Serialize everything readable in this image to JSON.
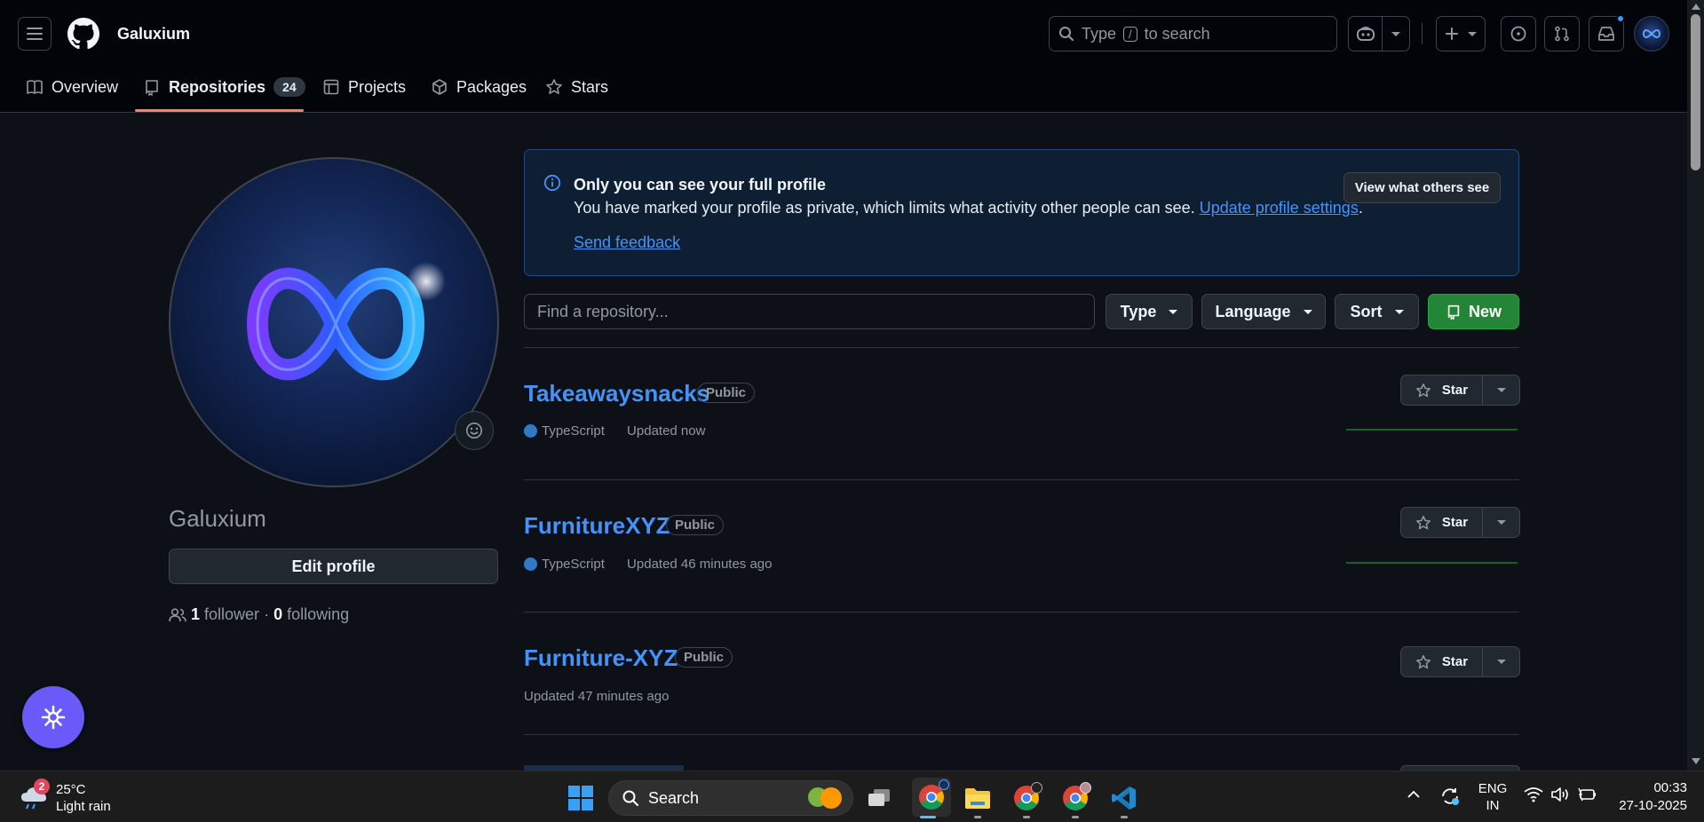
{
  "header": {
    "username": "Galuxium",
    "search_prefix": "Type",
    "search_key": "/",
    "search_suffix": "to search"
  },
  "tabs": [
    {
      "label": "Overview"
    },
    {
      "label": "Repositories",
      "count": "24"
    },
    {
      "label": "Projects"
    },
    {
      "label": "Packages"
    },
    {
      "label": "Stars"
    }
  ],
  "profile": {
    "name": "Galuxium",
    "edit_label": "Edit profile",
    "followers_count": "1",
    "followers_label": "follower",
    "following_count": "0",
    "following_label": "following",
    "sep": "·"
  },
  "notice": {
    "title": "Only you can see your full profile",
    "body": "You have marked your profile as private, which limits what activity other people can see.",
    "link": "Update profile settings",
    "period": ".",
    "feedback": "Send feedback",
    "button": "View what others see"
  },
  "filter": {
    "placeholder": "Find a repository...",
    "type": "Type",
    "language": "Language",
    "sort": "Sort",
    "new": "New"
  },
  "repos": [
    {
      "name": "Takeawaysnacks",
      "visibility": "Public",
      "language": "TypeScript",
      "updated": "Updated now",
      "star": "Star"
    },
    {
      "name": "FurnitureXYZ",
      "visibility": "Public",
      "language": "TypeScript",
      "updated": "Updated 46 minutes ago",
      "star": "Star"
    },
    {
      "name": "Furniture-XYZ",
      "visibility": "Public",
      "updated": "Updated 47 minutes ago",
      "star": "Star"
    }
  ],
  "taskbar": {
    "weather_badge": "2",
    "temperature": "25°C",
    "condition": "Light rain",
    "search_label": "Search",
    "lang_top": "ENG",
    "lang_bottom": "IN",
    "time": "00:33",
    "date": "27-10-2025"
  },
  "colors": {
    "accent_link": "#4493f8",
    "new_button": "#238636",
    "typescript": "#3178c6",
    "tab_underline": "#f78166"
  }
}
